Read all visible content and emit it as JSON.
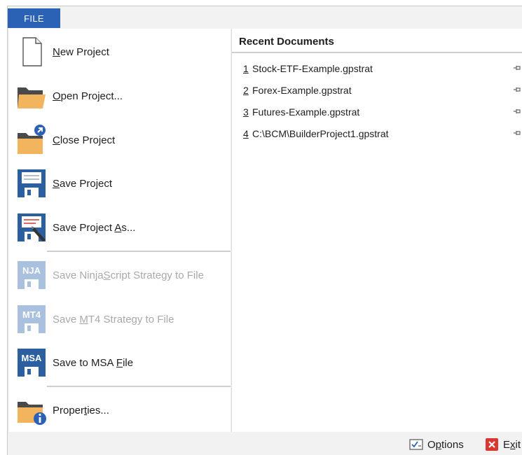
{
  "tab": {
    "label": "FILE"
  },
  "menu": [
    {
      "id": "new",
      "pre": "",
      "key": "N",
      "post": "ew Project",
      "icon": "new-document-icon",
      "enabled": true
    },
    {
      "id": "open",
      "pre": "",
      "key": "O",
      "post": "pen Project...",
      "icon": "open-folder-icon",
      "enabled": true
    },
    {
      "id": "close",
      "pre": "",
      "key": "C",
      "post": "lose Project",
      "icon": "close-folder-icon",
      "enabled": true
    },
    {
      "id": "save",
      "pre": "",
      "key": "S",
      "post": "ave Project",
      "icon": "floppy-disk-icon",
      "enabled": true
    },
    {
      "id": "saveas",
      "pre": "Save Project ",
      "key": "A",
      "post": "s...",
      "icon": "save-as-icon",
      "enabled": true
    },
    {
      "id": "nja",
      "pre": "Save Ninja",
      "key": "S",
      "post": "cript Strategy to File",
      "icon": "nja-disk-icon",
      "enabled": false
    },
    {
      "id": "mt4",
      "pre": "Save ",
      "key": "M",
      "post": "T4 Strategy to File",
      "icon": "mt4-disk-icon",
      "enabled": false
    },
    {
      "id": "msa",
      "pre": "Save to MSA ",
      "key": "F",
      "post": "ile",
      "icon": "msa-disk-icon",
      "enabled": true
    },
    {
      "id": "props",
      "pre": "Proper",
      "key": "t",
      "post": "ies...",
      "icon": "folder-info-icon",
      "enabled": true
    }
  ],
  "disk_badges": {
    "nja": "NJA",
    "mt4": "MT4",
    "msa": "MSA"
  },
  "recent": {
    "title": "Recent Documents",
    "items": [
      {
        "num": "1",
        "name": " Stock-ETF-Example.gpstrat"
      },
      {
        "num": "2",
        "name": " Forex-Example.gpstrat"
      },
      {
        "num": "3",
        "name": " Futures-Example.gpstrat"
      },
      {
        "num": "4",
        "name": " C:\\BCM\\BuilderProject1.gpstrat"
      }
    ]
  },
  "footer": {
    "options": {
      "pre": "O",
      "key": "p",
      "post": "tions"
    },
    "exit": {
      "pre": "E",
      "key": "x",
      "post": "it"
    }
  },
  "colors": {
    "accent": "#2b62b5",
    "folder": "#f2b45c",
    "disk_blue": "#2b5fa0",
    "disk_disabled": "#a9c1de",
    "exit_red": "#d9382f"
  }
}
